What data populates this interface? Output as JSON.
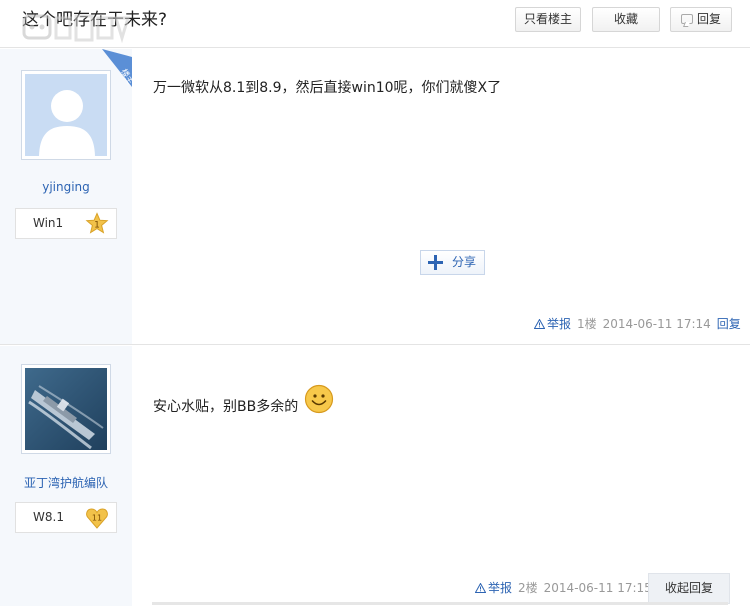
{
  "thread": {
    "title": "这个吧存在于未来?",
    "buttons": {
      "only_op": "只看楼主",
      "favorite": "收藏",
      "reply": "回复"
    }
  },
  "posts": [
    {
      "username": "yjinging",
      "level_name": "Win1",
      "level_number": "1",
      "op_badge": "楼主",
      "content": "万一微软从8.1到8.9，然后直接win10呢，你们就傻X了",
      "share_label": "分享",
      "report_label": "举报",
      "floor": "1楼",
      "time": "2014-06-11 17:14",
      "reply_label": "回复"
    },
    {
      "username": "亚丁湾护航编队",
      "level_name": "W8.1",
      "level_number": "11",
      "content": "安心水贴，别BB多余的",
      "report_label": "举报",
      "floor": "2楼",
      "time": "2014-06-11 17:15",
      "collapse_label": "收起回复"
    }
  ],
  "colors": {
    "link": "#2d64b3",
    "sidebar_bg": "#f5f8fc",
    "badge_gold": "#f2c24a",
    "op_ribbon": "#5b8fd6"
  },
  "icons": [
    "reply-icon",
    "warning-icon",
    "plus-icon",
    "star-level-icon",
    "heart-level-icon",
    "smiley-emoji",
    "default-avatar",
    "ship-avatar"
  ]
}
